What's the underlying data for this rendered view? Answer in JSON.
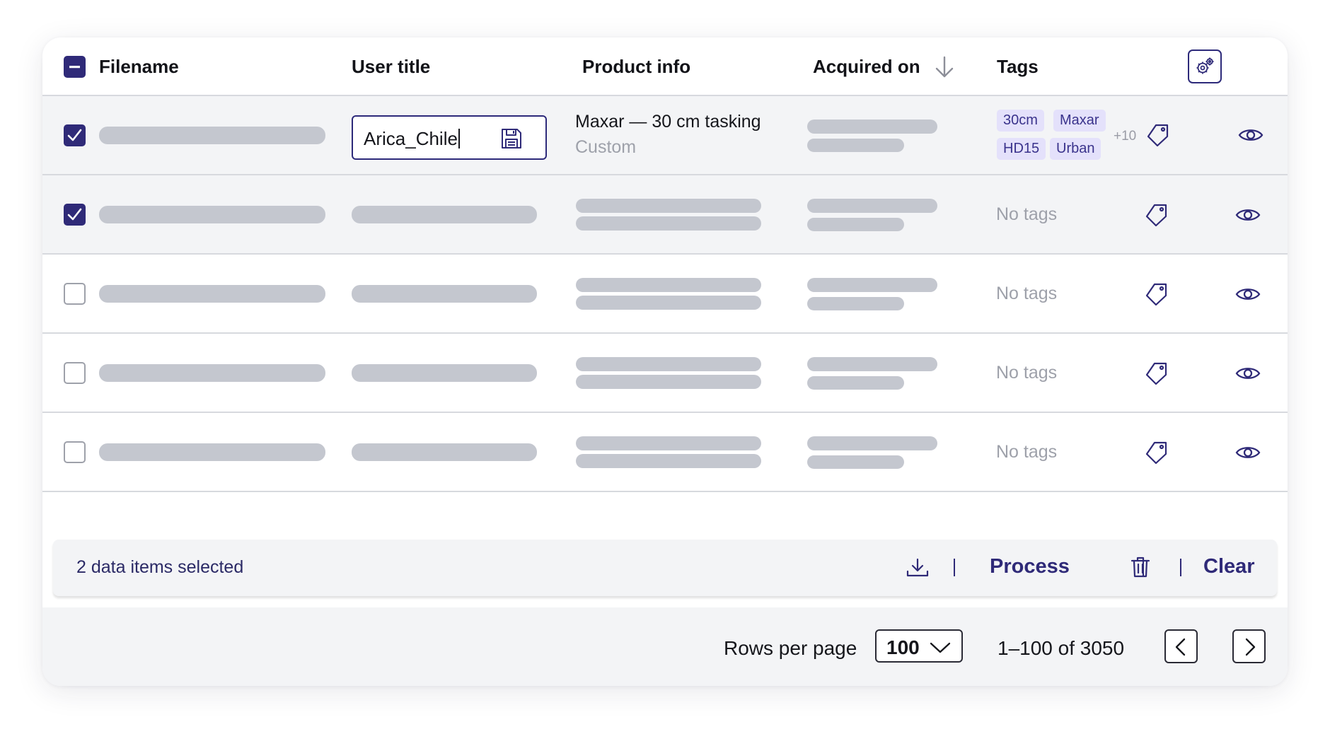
{
  "table": {
    "columns": {
      "filename": "Filename",
      "user_title": "User title",
      "product_info": "Product info",
      "acquired_on": "Acquired on",
      "tags": "Tags"
    },
    "sorted_column": "Acquired on",
    "sort_direction": "descending"
  },
  "rows": [
    {
      "selected": true,
      "user_title_value": "Arica_Chile",
      "product_main": "Maxar — 30 cm tasking",
      "product_sub": "Custom",
      "tags": [
        "30cm",
        "Maxar",
        "HD15",
        "Urban"
      ],
      "more_tags": "+10"
    },
    {
      "selected": true,
      "tags_text": "No tags"
    },
    {
      "selected": false,
      "tags_text": "No tags"
    },
    {
      "selected": false,
      "tags_text": "No tags"
    },
    {
      "selected": false,
      "tags_text": "No tags"
    }
  ],
  "selection_bar": {
    "text": "2 data items selected",
    "process_label": "Process",
    "clear_label": "Clear"
  },
  "pagination": {
    "rows_per_page_label": "Rows per page",
    "rows_per_page_value": "100",
    "range_text": "1–100 of 3050"
  },
  "colors": {
    "accent": "#2f2a78",
    "tag_bg": "#e4e1fb",
    "skeleton": "#c4c7cf"
  }
}
